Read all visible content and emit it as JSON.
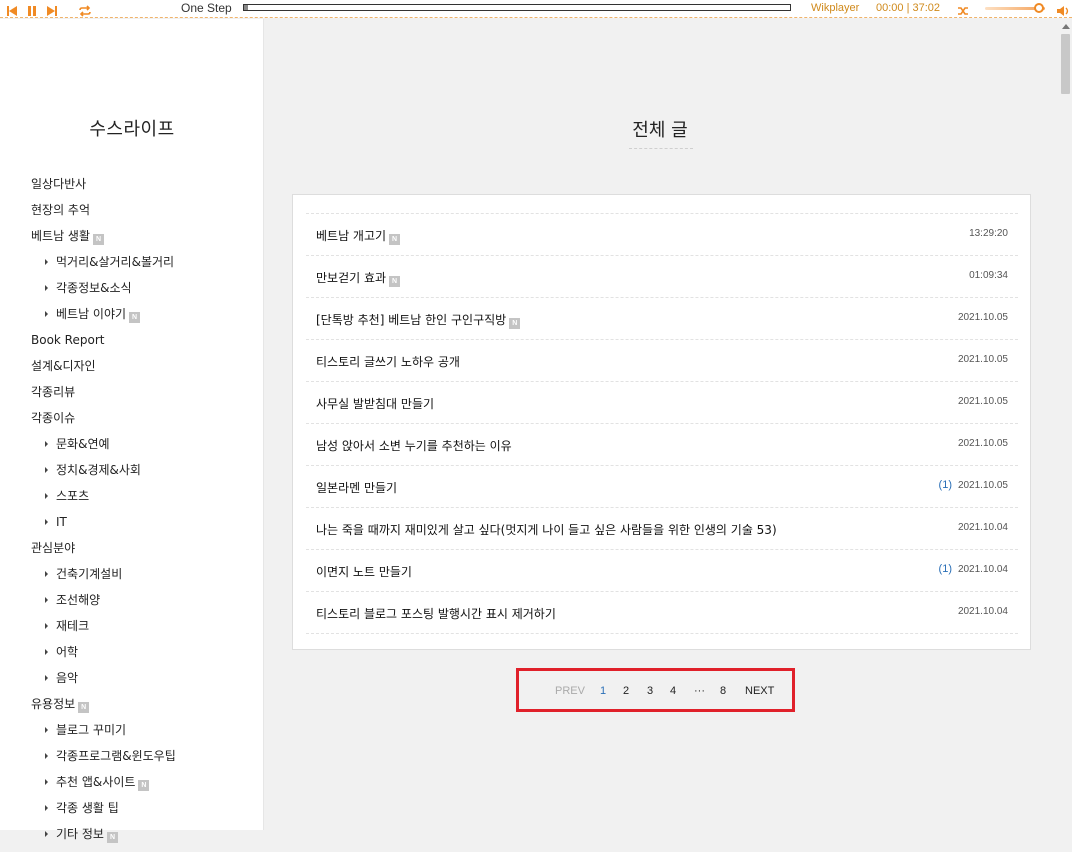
{
  "player": {
    "track_title": "One Step",
    "brand": "Wikplayer",
    "time": "00:00 | 37:02",
    "progress": 0.0
  },
  "blog": {
    "title": "수스라이프"
  },
  "categories": [
    {
      "label": "일상다반사",
      "sub": false,
      "new": false
    },
    {
      "label": "현장의 추억",
      "sub": false,
      "new": false
    },
    {
      "label": "베트남 생활",
      "sub": false,
      "new": true
    },
    {
      "label": "먹거리&살거리&볼거리",
      "sub": true,
      "new": false
    },
    {
      "label": "각종정보&소식",
      "sub": true,
      "new": false
    },
    {
      "label": "베트남 이야기",
      "sub": true,
      "new": true
    },
    {
      "label": "Book Report",
      "sub": false,
      "new": false
    },
    {
      "label": "설계&디자인",
      "sub": false,
      "new": false
    },
    {
      "label": "각종리뷰",
      "sub": false,
      "new": false
    },
    {
      "label": "각종이슈",
      "sub": false,
      "new": false
    },
    {
      "label": "문화&연예",
      "sub": true,
      "new": false
    },
    {
      "label": "정치&경제&사회",
      "sub": true,
      "new": false
    },
    {
      "label": "스포츠",
      "sub": true,
      "new": false
    },
    {
      "label": "IT",
      "sub": true,
      "new": false
    },
    {
      "label": "관심분야",
      "sub": false,
      "new": false
    },
    {
      "label": "건축기계설비",
      "sub": true,
      "new": false
    },
    {
      "label": "조선해양",
      "sub": true,
      "new": false
    },
    {
      "label": "재테크",
      "sub": true,
      "new": false
    },
    {
      "label": "어학",
      "sub": true,
      "new": false
    },
    {
      "label": "음악",
      "sub": true,
      "new": false
    },
    {
      "label": "유용정보",
      "sub": false,
      "new": true
    },
    {
      "label": "블로그 꾸미기",
      "sub": true,
      "new": false
    },
    {
      "label": "각종프로그램&윈도우팁",
      "sub": true,
      "new": false
    },
    {
      "label": "추천 앱&사이트",
      "sub": true,
      "new": true
    },
    {
      "label": "각종 생활 팁",
      "sub": true,
      "new": false
    },
    {
      "label": "기타 정보",
      "sub": true,
      "new": true
    }
  ],
  "new_badge": "N",
  "section": {
    "title": "전체 글"
  },
  "posts": [
    {
      "title": "베트남 개고기",
      "new": true,
      "comments": "",
      "date": "13:29:20"
    },
    {
      "title": "만보걷기 효과",
      "new": true,
      "comments": "",
      "date": "01:09:34"
    },
    {
      "title": "[단톡방 추천] 베트남 한인 구인구직방",
      "new": true,
      "comments": "",
      "date": "2021.10.05"
    },
    {
      "title": "티스토리 글쓰기 노하우 공개",
      "new": false,
      "comments": "",
      "date": "2021.10.05"
    },
    {
      "title": "사무실 발받침대 만들기",
      "new": false,
      "comments": "",
      "date": "2021.10.05"
    },
    {
      "title": "남성 앉아서 소변 누기를 추천하는 이유",
      "new": false,
      "comments": "",
      "date": "2021.10.05"
    },
    {
      "title": "일본라멘 만들기",
      "new": false,
      "comments": "(1)",
      "date": "2021.10.05"
    },
    {
      "title": "나는 죽을 때까지 재미있게 살고 싶다(멋지게 나이 들고 싶은 사람들을 위한 인생의 기술 53)",
      "new": false,
      "comments": "",
      "date": "2021.10.04"
    },
    {
      "title": "이면지 노트 만들기",
      "new": false,
      "comments": "(1)",
      "date": "2021.10.04"
    },
    {
      "title": "티스토리 블로그 포스팅 발행시간 표시 제거하기",
      "new": false,
      "comments": "",
      "date": "2021.10.04"
    }
  ],
  "pagination": {
    "prev": "PREV",
    "pages": [
      "1",
      "2",
      "3",
      "4",
      "···",
      "8"
    ],
    "current": "1",
    "next": "NEXT"
  }
}
